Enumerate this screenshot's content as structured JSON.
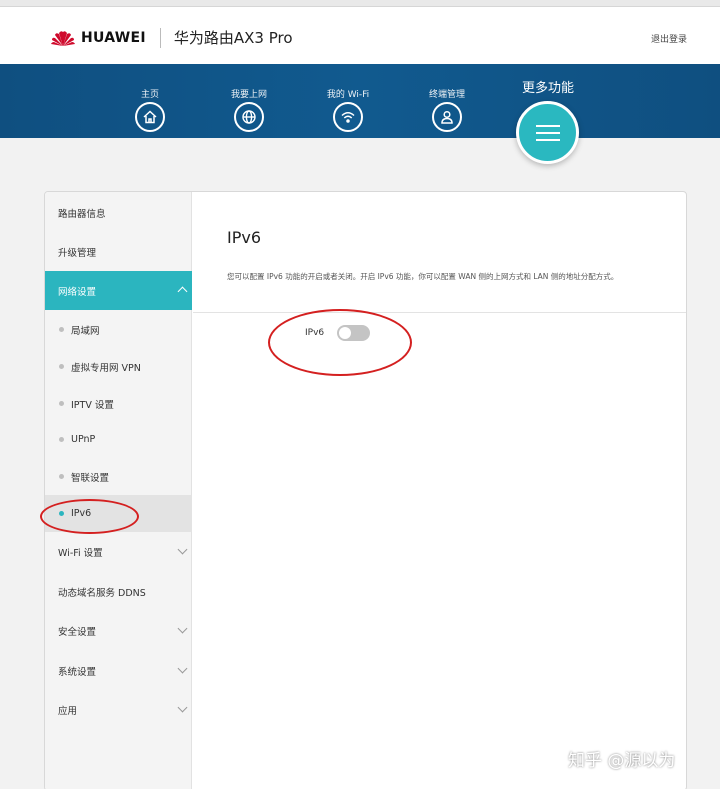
{
  "header": {
    "brand": "HUAWEI",
    "model": "华为路由AX3 Pro",
    "logout": "退出登录"
  },
  "nav": {
    "items": [
      {
        "label": "主页",
        "icon": "home-icon"
      },
      {
        "label": "我要上网",
        "icon": "globe-icon"
      },
      {
        "label": "我的 Wi-Fi",
        "icon": "wifi-icon"
      },
      {
        "label": "终端管理",
        "icon": "user-icon"
      }
    ],
    "more_label": "更多功能",
    "more_icon": "menu-icon"
  },
  "sidebar": {
    "items": [
      {
        "label": "路由器信息"
      },
      {
        "label": "升级管理"
      },
      {
        "label": "网络设置",
        "expanded": true
      },
      {
        "label": "Wi-Fi 设置"
      },
      {
        "label": "动态域名服务 DDNS"
      },
      {
        "label": "安全设置"
      },
      {
        "label": "系统设置"
      },
      {
        "label": "应用"
      }
    ],
    "sub_items": [
      {
        "label": "局域网"
      },
      {
        "label": "虚拟专用网 VPN"
      },
      {
        "label": "IPTV 设置"
      },
      {
        "label": "UPnP"
      },
      {
        "label": "智联设置"
      },
      {
        "label": "IPv6",
        "selected": true
      }
    ]
  },
  "content": {
    "title": "IPv6",
    "description": "您可以配置 IPv6 功能的开启或者关闭。开启 IPv6 功能，你可以配置 WAN 侧的上网方式和 LAN 侧的地址分配方式。",
    "toggle_label": "IPv6",
    "toggle_on": false
  },
  "watermark": "知乎 @源以为",
  "colors": {
    "nav_bg": "#0f4f80",
    "accent": "#2bb5bf",
    "annotation": "#d42020"
  }
}
